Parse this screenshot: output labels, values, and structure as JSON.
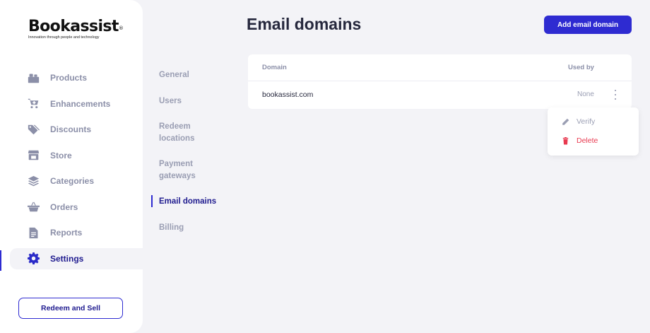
{
  "logo": {
    "title": "Bookassist",
    "reg": "®",
    "tagline": "Innovation through people and technology"
  },
  "nav": {
    "items": [
      {
        "label": "Products",
        "icon": "products-icon"
      },
      {
        "label": "Enhancements",
        "icon": "cart-icon"
      },
      {
        "label": "Discounts",
        "icon": "tags-icon"
      },
      {
        "label": "Store",
        "icon": "store-icon"
      },
      {
        "label": "Categories",
        "icon": "layers-icon"
      },
      {
        "label": "Orders",
        "icon": "basket-icon"
      },
      {
        "label": "Reports",
        "icon": "report-icon"
      },
      {
        "label": "Settings",
        "icon": "gear-icon",
        "active": true
      }
    ],
    "redeem_button": "Redeem and Sell"
  },
  "subnav": {
    "items": [
      {
        "label": "General"
      },
      {
        "label": "Users"
      },
      {
        "label": "Redeem locations"
      },
      {
        "label": "Payment gateways"
      },
      {
        "label": "Email domains",
        "active": true
      },
      {
        "label": "Billing"
      }
    ]
  },
  "header": {
    "title": "Email domains",
    "add_button": "Add email domain"
  },
  "table": {
    "columns": [
      "Domain",
      "Used by"
    ],
    "rows": [
      {
        "domain": "bookassist.com",
        "used_by": "None"
      }
    ]
  },
  "row_menu": {
    "items": [
      {
        "label": "Verify",
        "icon": "pencil-icon"
      },
      {
        "label": "Delete",
        "icon": "trash-icon"
      }
    ]
  },
  "colors": {
    "accent": "#2e2bd1",
    "active_text": "#1f1b8f",
    "muted": "#8b8fa8",
    "danger": "#e8394f",
    "background": "#f3f3f7"
  }
}
